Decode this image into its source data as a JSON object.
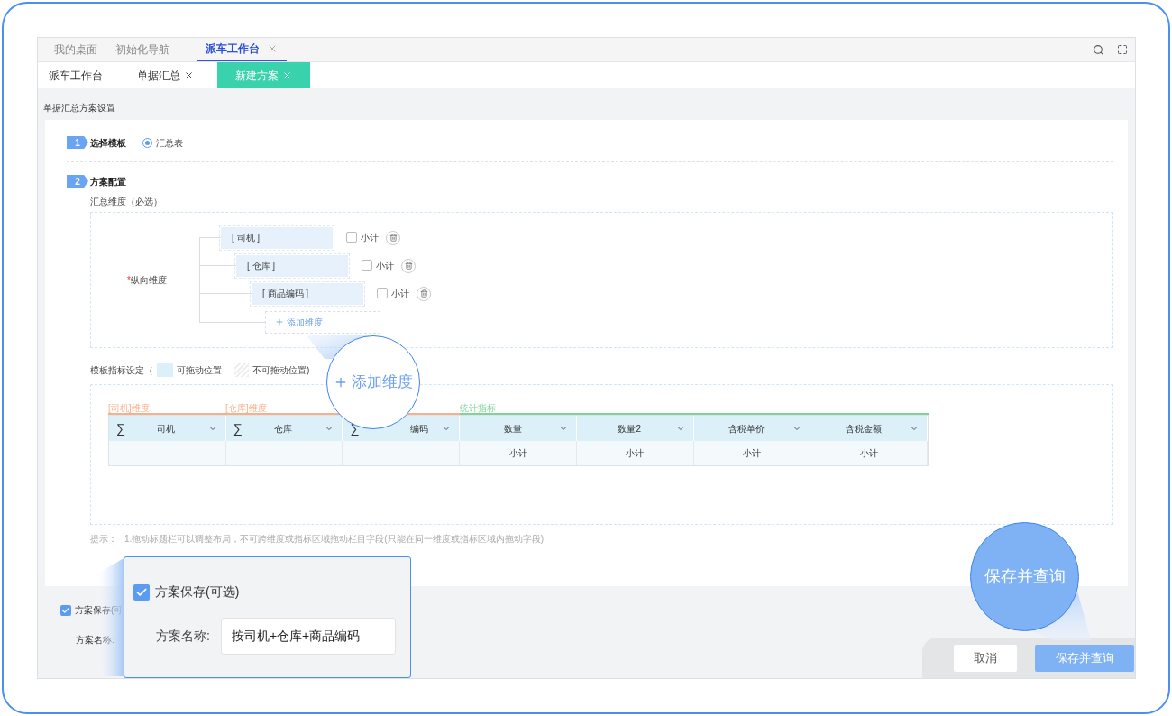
{
  "top_tabs": [
    {
      "label": "我的桌面",
      "selected": false,
      "closable": false
    },
    {
      "label": "初始化导航",
      "selected": false,
      "closable": false
    },
    {
      "label": "派车工作台",
      "selected": true,
      "closable": true
    }
  ],
  "sub_tabs": [
    {
      "label": "派车工作台",
      "selected": false,
      "closable": false
    },
    {
      "label": "单据汇总",
      "selected": false,
      "closable": true
    },
    {
      "label": "新建方案",
      "selected": true,
      "closable": true
    }
  ],
  "section_title": "单据汇总方案设置",
  "steps": [
    {
      "number": "1",
      "title": "选择模板"
    },
    {
      "number": "2",
      "title": "方案配置"
    }
  ],
  "template_option": {
    "label": "汇总表",
    "selected": true
  },
  "dimensions_label": "汇总维度（必选）",
  "vertical_dimension": {
    "label": "纵向维度",
    "required_mark": "*",
    "add_label": "添加维度",
    "items": [
      {
        "field": "[ 司机 ]",
        "subtotal_label": "小计",
        "checked": false
      },
      {
        "field": "[ 仓库 ]",
        "subtotal_label": "小计",
        "checked": false
      },
      {
        "field": "[ 商品编码 ]",
        "subtotal_label": "小计",
        "checked": false
      }
    ]
  },
  "metric_settings": {
    "label": "模板指标设定（",
    "draggable_label": "可拖动位置",
    "fixed_label": "不可拖动位置)"
  },
  "groups": [
    {
      "label": "[司机]维度",
      "color": "#f7b08a",
      "columns": [
        {
          "prefix": "∑",
          "label": "司机"
        }
      ]
    },
    {
      "label": "[仓库]维度",
      "color": "#f7b08a",
      "columns": [
        {
          "prefix": "∑",
          "label": "仓库"
        },
        {
          "prefix": "∑",
          "label": "编码"
        }
      ]
    },
    {
      "label": "统计指标",
      "color": "#7fd49a",
      "columns": [
        {
          "label": "数量",
          "footer": "小计"
        },
        {
          "label": "数量2",
          "footer": "小计"
        },
        {
          "label": "含税单价",
          "footer": "小计"
        },
        {
          "label": "含税金额",
          "footer": "小计"
        }
      ]
    }
  ],
  "hint": {
    "label": "提示：",
    "lines": [
      "1.拖动标题栏可以调整布局，不可跨维度或指标区域拖动栏目字段(只能在同一维度或指标区域内拖动字段)"
    ]
  },
  "save": {
    "checkbox_label": "方案保存(可",
    "checked": true,
    "name_label": "方案名称:"
  },
  "buttons": [
    {
      "label": "取消",
      "kind": "secondary"
    },
    {
      "label": "保存并查询",
      "kind": "primary"
    }
  ],
  "zoom_add": {
    "label": "添加维度"
  },
  "zoom_save": {
    "checkbox_label": "方案保存(可选)",
    "checked": true,
    "name_label": "方案名称:",
    "name_value": "按司机+仓库+商品编码"
  },
  "zoom_button": {
    "label": "保存并查询"
  }
}
